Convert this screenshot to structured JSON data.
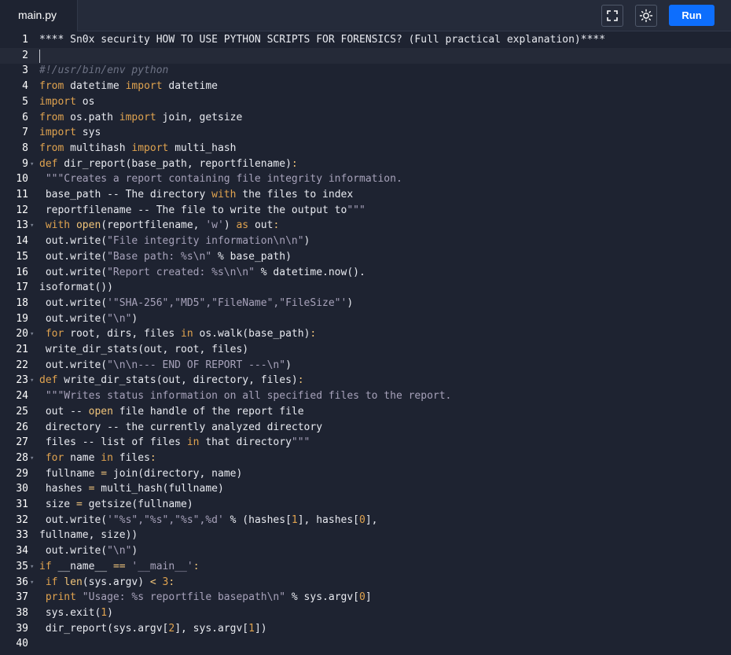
{
  "file_tab": {
    "label": "main.py"
  },
  "toolbar": {
    "fullscreen_icon": "fullscreen-icon",
    "theme_icon": "sun-icon",
    "run_label": "Run"
  },
  "colors": {
    "background": "#1e2331",
    "run_button": "#0d6efd",
    "keyword": "#e0a34f",
    "string": "#a7a2ba"
  },
  "editor": {
    "active_line": 2,
    "fold_lines": [
      9,
      13,
      20,
      23,
      28,
      35,
      36
    ],
    "lines": [
      "**** Sn0x security HOW TO USE PYTHON SCRIPTS FOR FORENSICS? (Full practical explanation)****",
      "",
      "#!/usr/bin/env python",
      "from datetime import datetime",
      "import os",
      "from os.path import join, getsize",
      "import sys",
      "from multihash import multi_hash",
      "def dir_report(base_path, reportfilename):",
      " \"\"\"Creates a report containing file integrity information.",
      " base_path -- The directory with the files to index",
      " reportfilename -- The file to write the output to\"\"\"",
      " with open(reportfilename, 'w') as out:",
      " out.write(\"File integrity information\\n\\n\")",
      " out.write(\"Base path: %s\\n\" % base_path)",
      " out.write(\"Report created: %s\\n\\n\" % datetime.now().",
      "isoformat())",
      " out.write('\"SHA-256\",\"MD5\",\"FileName\",\"FileSize\"')",
      " out.write(\"\\n\")",
      " for root, dirs, files in os.walk(base_path):",
      " write_dir_stats(out, root, files)",
      " out.write(\"\\n\\n--- END OF REPORT ---\\n\")",
      "def write_dir_stats(out, directory, files):",
      " \"\"\"Writes status information on all specified files to the report.",
      " out -- open file handle of the report file",
      " directory -- the currently analyzed directory",
      " files -- list of files in that directory\"\"\"",
      " for name in files:",
      " fullname = join(directory, name)",
      " hashes = multi_hash(fullname)",
      " size = getsize(fullname)",
      " out.write('\"%s\",\"%s\",\"%s\",%d' % (hashes[1], hashes[0],",
      "fullname, size))",
      " out.write(\"\\n\")",
      "if __name__ == '__main__':",
      " if len(sys.argv) < 3:",
      " print \"Usage: %s reportfile basepath\\n\" % sys.argv[0]",
      " sys.exit(1)",
      " dir_report(sys.argv[2], sys.argv[1])",
      ""
    ]
  }
}
